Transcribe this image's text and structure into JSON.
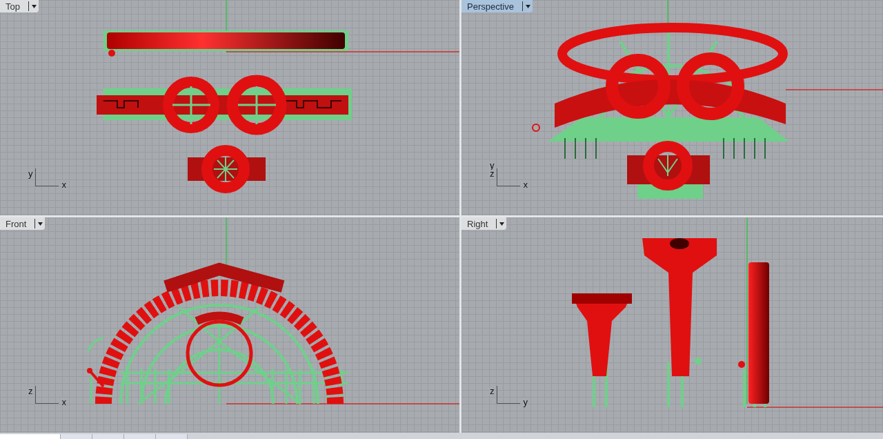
{
  "viewports": [
    {
      "title": "Top",
      "selected": false,
      "kind": "top",
      "axis_vertical": [
        "y"
      ],
      "axis_horizontal": "x"
    },
    {
      "title": "Perspective",
      "selected": true,
      "kind": "perspective",
      "axis_vertical": [
        "y",
        "z"
      ],
      "axis_horizontal": "x"
    },
    {
      "title": "Front",
      "selected": false,
      "kind": "front",
      "axis_vertical": [
        "z"
      ],
      "axis_horizontal": "x"
    },
    {
      "title": "Right",
      "selected": false,
      "kind": "right",
      "axis_vertical": [
        "z"
      ],
      "axis_horizontal": "y"
    }
  ],
  "bottom_tabs": [
    {
      "selected": true
    },
    {
      "selected": false
    },
    {
      "selected": false
    },
    {
      "selected": false
    },
    {
      "selected": false
    }
  ]
}
